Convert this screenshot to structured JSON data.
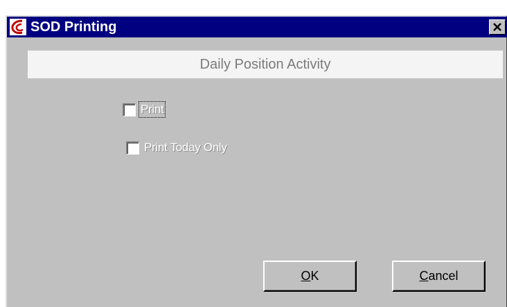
{
  "window": {
    "title": "SOD Printing",
    "close_symbol": "✕",
    "app_icon": "app-logo-icon"
  },
  "panel": {
    "header": "Daily Position Activity"
  },
  "options": [
    {
      "label": "Print",
      "checked": false,
      "focused": true
    },
    {
      "label": "Print Today Only",
      "checked": false,
      "focused": false
    }
  ],
  "buttons": {
    "ok": {
      "accel": "O",
      "rest": "K"
    },
    "cancel": {
      "accel": "C",
      "rest": "ancel"
    }
  },
  "colors": {
    "titlebar": "#000080",
    "face": "#c0c0c0",
    "icon_red": "#c00000"
  }
}
